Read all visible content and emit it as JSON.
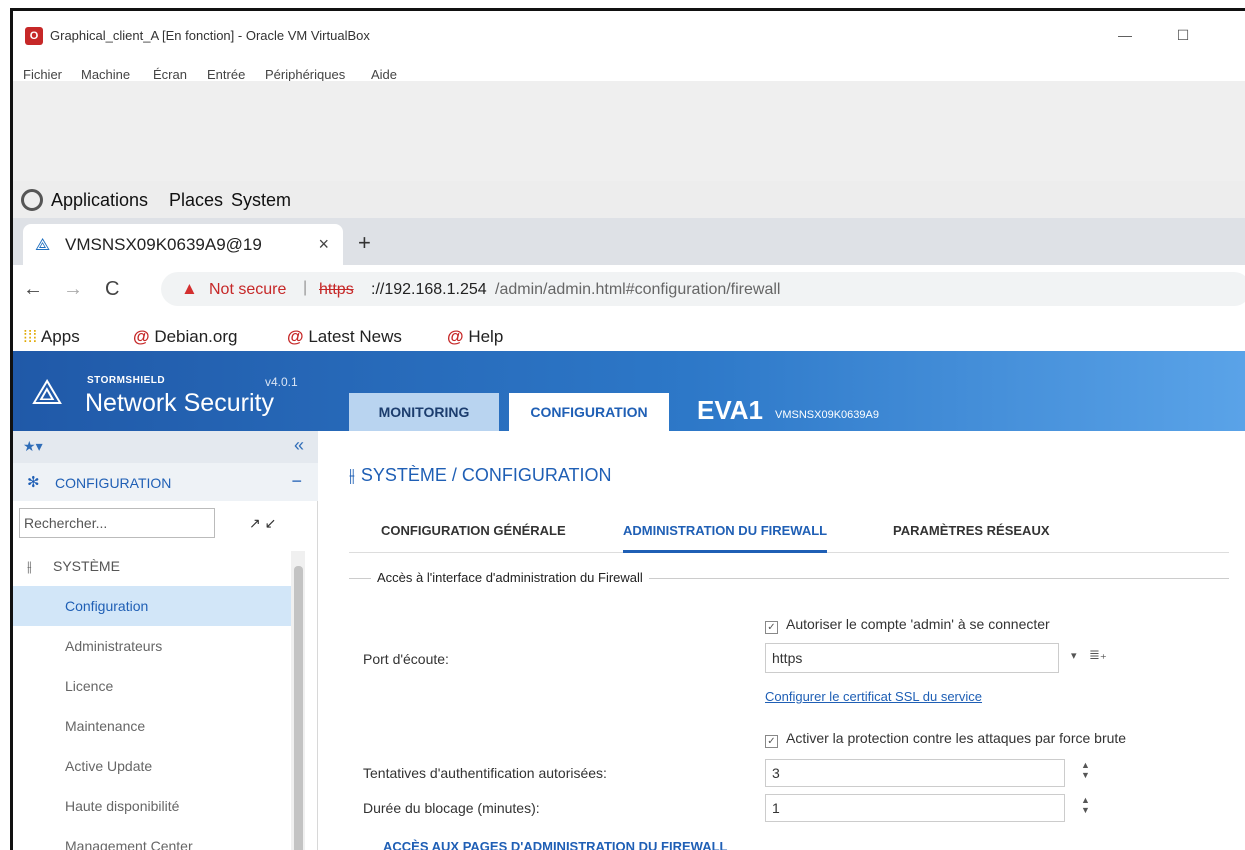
{
  "vbox": {
    "title": "Graphical_client_A [En fonction] - Oracle VM VirtualBox",
    "logo_text": "O",
    "minimize_glyph": "—",
    "maximize_glyph": "☐",
    "menu": [
      "Fichier",
      "Machine",
      "Écran",
      "Entrée",
      "Périphériques",
      "Aide"
    ]
  },
  "desktop": {
    "menu": [
      "Applications",
      "Places",
      "System"
    ]
  },
  "browser": {
    "tab_title": "VMSNSX09K0639A9@19",
    "tab_close": "×",
    "new_tab": "+",
    "back": "←",
    "forward": "→",
    "reload": "C",
    "security_label": "Not secure",
    "url_separator": "|",
    "url_protocol": "https",
    "url_host": "://192.168.1.254",
    "url_path": "/admin/admin.html#configuration/firewall",
    "bookmarks": [
      "Apps",
      "Debian.org",
      "Latest News",
      "Help"
    ]
  },
  "sns": {
    "brand": "STORMSHIELD",
    "product": "Network Security",
    "version": "v4.0.1",
    "tabs": [
      "MONITORING",
      "CONFIGURATION"
    ],
    "device_name": "EVA1",
    "device_serial": "VMSNSX09K0639A9"
  },
  "sidebar": {
    "fav_star": "★",
    "fav_caret": "▾",
    "collapse": "«",
    "section_title": "CONFIGURATION",
    "section_toggle": "−",
    "search_placeholder": "Rechercher...",
    "expand_collapse": "↗ ↙",
    "group": "SYSTÈME",
    "items": [
      "Configuration",
      "Administrateurs",
      "Licence",
      "Maintenance",
      "Active Update",
      "Haute disponibilité",
      "Management Center"
    ]
  },
  "main": {
    "title": "SYSTÈME / CONFIGURATION",
    "tabs": [
      "CONFIGURATION GÉNÉRALE",
      "ADMINISTRATION DU FIREWALL",
      "PARAMÈTRES RÉSEAUX"
    ],
    "active_tab_index": 1,
    "legend": "Accès à l'interface d'administration du Firewall",
    "allow_admin_label": "Autoriser le compte 'admin' à se connecter",
    "port_label": "Port d'écoute:",
    "port_value": "https",
    "ssl_link": "Configurer le certificat SSL du service",
    "bruteforce_label": "Activer la protection contre les attaques par force brute",
    "attempts_label": "Tentatives d'authentification autorisées:",
    "attempts_value": "3",
    "block_label": "Durée du blocage (minutes):",
    "block_value": "1",
    "access_pages_link": "ACCÈS AUX PAGES D'ADMINISTRATION DU FIREWALL"
  },
  "colors": {
    "accent": "#1f5fb5",
    "header_gradient_start": "#2059a8",
    "header_gradient_end": "#5aa3e8",
    "not_secure": "#c62828"
  }
}
